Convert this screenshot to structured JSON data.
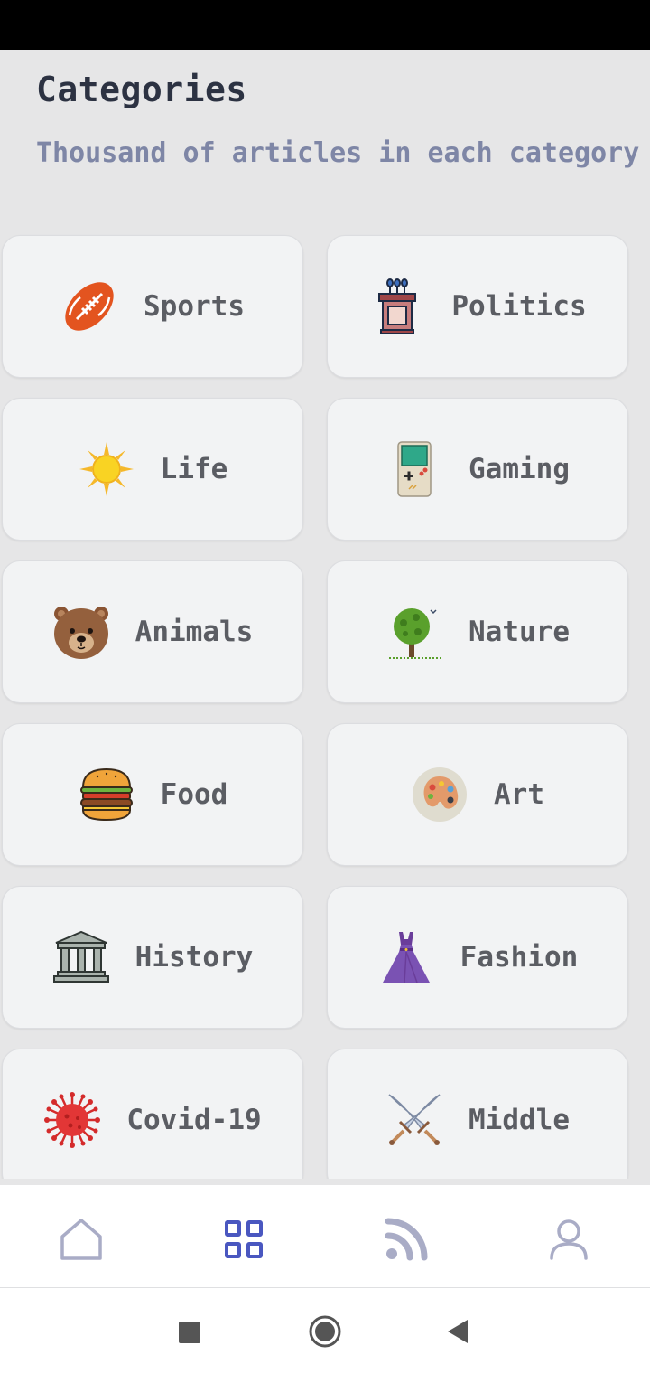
{
  "header": {
    "title": "Categories",
    "subtitle": "Thousand of articles in each category"
  },
  "categories": [
    {
      "label": "Sports",
      "icon": "football-icon"
    },
    {
      "label": "Politics",
      "icon": "podium-icon"
    },
    {
      "label": "Life",
      "icon": "sun-icon"
    },
    {
      "label": "Gaming",
      "icon": "gameboy-icon"
    },
    {
      "label": "Animals",
      "icon": "bear-icon"
    },
    {
      "label": "Nature",
      "icon": "tree-icon"
    },
    {
      "label": "Food",
      "icon": "burger-icon"
    },
    {
      "label": "Art",
      "icon": "palette-icon"
    },
    {
      "label": "History",
      "icon": "museum-icon"
    },
    {
      "label": "Fashion",
      "icon": "dress-icon"
    },
    {
      "label": "Covid-19",
      "icon": "virus-icon"
    },
    {
      "label": "Middle",
      "icon": "crossed-swords-icon"
    }
  ],
  "bottom_nav": [
    {
      "icon": "home-icon",
      "active": false
    },
    {
      "icon": "grid-icon",
      "active": true
    },
    {
      "icon": "rss-icon",
      "active": false
    },
    {
      "icon": "profile-icon",
      "active": false
    }
  ],
  "colors": {
    "accent": "#4a57c0",
    "inactive": "#a9acc6",
    "title": "#2c3242",
    "subtitle": "#7e86a6",
    "card_bg": "#f2f3f4",
    "card_text": "#5b5d63"
  }
}
